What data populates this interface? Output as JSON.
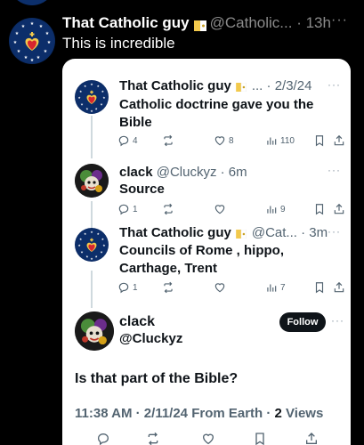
{
  "outer_tweet": {
    "name": "That Catholic guy",
    "handle": "@Catholic...",
    "time": "13h",
    "text": "This is incredible",
    "more": "···"
  },
  "quoted_thread": [
    {
      "name": "That Catholic guy",
      "handle": "...",
      "time": "2/3/24",
      "text": "Catholic doctrine gave you the Bible",
      "replies": "4",
      "retweets": "",
      "likes": "8",
      "views": "110",
      "more": "···"
    },
    {
      "name": "clack",
      "handle": "@Cluckyz",
      "time": "6m",
      "text": "Source",
      "replies": "1",
      "retweets": "",
      "likes": "",
      "views": "9",
      "more": "···"
    },
    {
      "name": "That Catholic guy",
      "handle": "@Cat...",
      "time": "3m",
      "text": "Councils of Rome , hippo, Carthage, Trent",
      "replies": "1",
      "retweets": "",
      "likes": "",
      "views": "7",
      "more": "···"
    }
  ],
  "main_tweet": {
    "name": "clack",
    "handle": "@Cluckyz",
    "follow_label": "Follow",
    "more": "···",
    "text": "Is that part of the Bible?",
    "meta_time": "11:38 AM · 2/11/24 From Earth · ",
    "views_count": "2",
    "views_label": " Views"
  },
  "separator": " · ",
  "icons": [
    "reply-icon",
    "retweet-icon",
    "like-icon",
    "views-icon",
    "bookmark-icon",
    "share-icon"
  ],
  "colors": {
    "accent": "#1d9bf0",
    "text": "#0f1419",
    "muted": "#536471",
    "background": "#000000",
    "card": "#ffffff"
  }
}
